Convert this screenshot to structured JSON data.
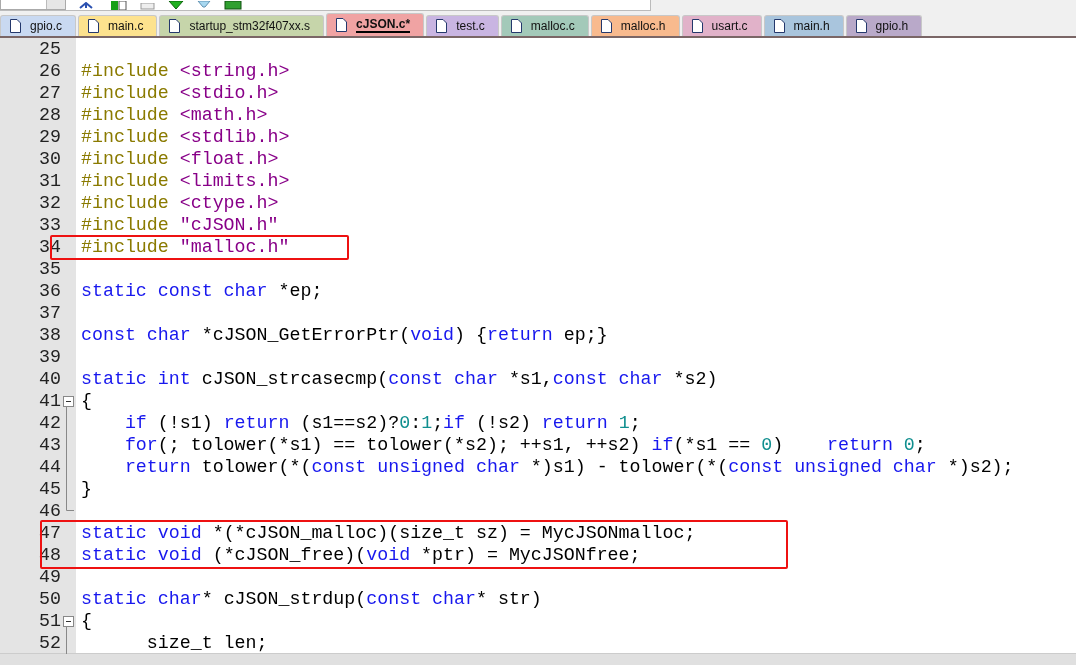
{
  "tabs": [
    {
      "label": "gpio.c",
      "selected": false,
      "color": "#c9d9f1"
    },
    {
      "label": "main.c",
      "selected": false,
      "color": "#fde28e"
    },
    {
      "label": "startup_stm32f407xx.s",
      "selected": false,
      "color": "#c6d5aa"
    },
    {
      "label": "cJSON.c*",
      "selected": true,
      "color": "#f0a3a3"
    },
    {
      "label": "test.c",
      "selected": false,
      "color": "#c9b5e2"
    },
    {
      "label": "malloc.c",
      "selected": false,
      "color": "#a3c9b9"
    },
    {
      "label": "malloc.h",
      "selected": false,
      "color": "#f8ba8e"
    },
    {
      "label": "usart.c",
      "selected": false,
      "color": "#e1b2c9"
    },
    {
      "label": "main.h",
      "selected": false,
      "color": "#a9c5dd"
    },
    {
      "label": "gpio.h",
      "selected": false,
      "color": "#b9a9c9"
    }
  ],
  "editor": {
    "lines": [
      {
        "number": "25"
      },
      {
        "number": "26",
        "tokens": [
          {
            "kind": "preproc",
            "text": "#include"
          },
          {
            "kind": "string",
            "text": " <string.h>"
          }
        ]
      },
      {
        "number": "27",
        "tokens": [
          {
            "kind": "preproc",
            "text": "#include"
          },
          {
            "kind": "string",
            "text": " <stdio.h>"
          }
        ]
      },
      {
        "number": "28",
        "tokens": [
          {
            "kind": "preproc",
            "text": "#include"
          },
          {
            "kind": "string",
            "text": " <math.h>"
          }
        ]
      },
      {
        "number": "29",
        "tokens": [
          {
            "kind": "preproc",
            "text": "#include"
          },
          {
            "kind": "string",
            "text": " <stdlib.h>"
          }
        ]
      },
      {
        "number": "30",
        "tokens": [
          {
            "kind": "preproc",
            "text": "#include"
          },
          {
            "kind": "string",
            "text": " <float.h>"
          }
        ]
      },
      {
        "number": "31",
        "tokens": [
          {
            "kind": "preproc",
            "text": "#include"
          },
          {
            "kind": "string",
            "text": " <limits.h>"
          }
        ]
      },
      {
        "number": "32",
        "tokens": [
          {
            "kind": "preproc",
            "text": "#include"
          },
          {
            "kind": "string",
            "text": " <ctype.h>"
          }
        ]
      },
      {
        "number": "33",
        "tokens": [
          {
            "kind": "preproc",
            "text": "#include"
          },
          {
            "kind": "string",
            "text": " \"cJSON.h\""
          }
        ]
      },
      {
        "number": "34",
        "highlighted": true,
        "tokens": [
          {
            "kind": "preproc",
            "text": "#include"
          },
          {
            "kind": "string",
            "text": " \"malloc.h\""
          }
        ]
      },
      {
        "number": "35"
      },
      {
        "number": "36",
        "tokens": [
          {
            "kind": "keyword",
            "text": "static const char"
          },
          {
            "kind": "plain",
            "text": " *ep;"
          }
        ]
      },
      {
        "number": "37"
      },
      {
        "number": "38",
        "tokens": [
          {
            "kind": "keyword",
            "text": "const char"
          },
          {
            "kind": "plain",
            "text": " *cJSON_GetErrorPtr("
          },
          {
            "kind": "keyword",
            "text": "void"
          },
          {
            "kind": "plain",
            "text": ") {"
          },
          {
            "kind": "keyword",
            "text": "return"
          },
          {
            "kind": "plain",
            "text": " ep;}"
          }
        ]
      },
      {
        "number": "39"
      },
      {
        "number": "40",
        "tokens": [
          {
            "kind": "keyword",
            "text": "static int"
          },
          {
            "kind": "plain",
            "text": " cJSON_strcasecmp("
          },
          {
            "kind": "keyword",
            "text": "const char"
          },
          {
            "kind": "plain",
            "text": " *s1,"
          },
          {
            "kind": "keyword",
            "text": "const char"
          },
          {
            "kind": "plain",
            "text": " *s2)"
          }
        ]
      },
      {
        "number": "41",
        "collapsible": true,
        "tokens": [
          {
            "kind": "plain",
            "text": "{"
          }
        ]
      },
      {
        "number": "42",
        "in_fold": true,
        "tokens": [
          {
            "kind": "keyword",
            "text": "    if"
          },
          {
            "kind": "plain",
            "text": " (!s1) "
          },
          {
            "kind": "keyword",
            "text": "return"
          },
          {
            "kind": "plain",
            "text": " (s1==s2)?"
          },
          {
            "kind": "number",
            "text": "0"
          },
          {
            "kind": "plain",
            "text": ":"
          },
          {
            "kind": "number",
            "text": "1"
          },
          {
            "kind": "plain",
            "text": ";"
          },
          {
            "kind": "keyword",
            "text": "if"
          },
          {
            "kind": "plain",
            "text": " (!s2) "
          },
          {
            "kind": "keyword",
            "text": "return"
          },
          {
            "kind": "number",
            "text": " 1"
          },
          {
            "kind": "plain",
            "text": ";"
          }
        ]
      },
      {
        "number": "43",
        "in_fold": true,
        "tokens": [
          {
            "kind": "keyword",
            "text": "    for"
          },
          {
            "kind": "plain",
            "text": "(; tolower(*s1) == tolower(*s2); ++s1, ++s2) "
          },
          {
            "kind": "keyword",
            "text": "if"
          },
          {
            "kind": "plain",
            "text": "(*s1 == "
          },
          {
            "kind": "number",
            "text": "0"
          },
          {
            "kind": "plain",
            "text": ")    "
          },
          {
            "kind": "keyword",
            "text": "return"
          },
          {
            "kind": "number",
            "text": " 0"
          },
          {
            "kind": "plain",
            "text": ";"
          }
        ]
      },
      {
        "number": "44",
        "in_fold": true,
        "tokens": [
          {
            "kind": "keyword",
            "text": "    return"
          },
          {
            "kind": "plain",
            "text": " tolower(*("
          },
          {
            "kind": "keyword",
            "text": "const unsigned char"
          },
          {
            "kind": "plain",
            "text": " *)s1) - tolower(*("
          },
          {
            "kind": "keyword",
            "text": "const unsigned char"
          },
          {
            "kind": "plain",
            "text": " *)s2);"
          }
        ]
      },
      {
        "number": "45",
        "in_fold": true,
        "tokens": [
          {
            "kind": "plain",
            "text": "}"
          }
        ]
      },
      {
        "number": "46",
        "in_fold": true,
        "fold_end": true
      },
      {
        "number": "47",
        "highlighted": true,
        "tokens": [
          {
            "kind": "keyword",
            "text": "static void"
          },
          {
            "kind": "plain",
            "text": " *(*cJSON_malloc)(size_t sz) = MycJSONmalloc;"
          }
        ]
      },
      {
        "number": "48",
        "highlighted": true,
        "tokens": [
          {
            "kind": "keyword",
            "text": "static void"
          },
          {
            "kind": "plain",
            "text": " (*cJSON_free)("
          },
          {
            "kind": "keyword",
            "text": "void"
          },
          {
            "kind": "plain",
            "text": " *ptr) = MycJSONfree;"
          }
        ]
      },
      {
        "number": "49"
      },
      {
        "number": "50",
        "tokens": [
          {
            "kind": "keyword",
            "text": "static char"
          },
          {
            "kind": "plain",
            "text": "* cJSON_strdup("
          },
          {
            "kind": "keyword",
            "text": "const char"
          },
          {
            "kind": "plain",
            "text": "* str)"
          }
        ]
      },
      {
        "number": "51",
        "collapsible": true,
        "tokens": [
          {
            "kind": "plain",
            "text": "{"
          }
        ]
      },
      {
        "number": "52",
        "in_fold": true,
        "tokens": [
          {
            "kind": "plain",
            "text": "      size_t len;"
          }
        ]
      }
    ]
  }
}
